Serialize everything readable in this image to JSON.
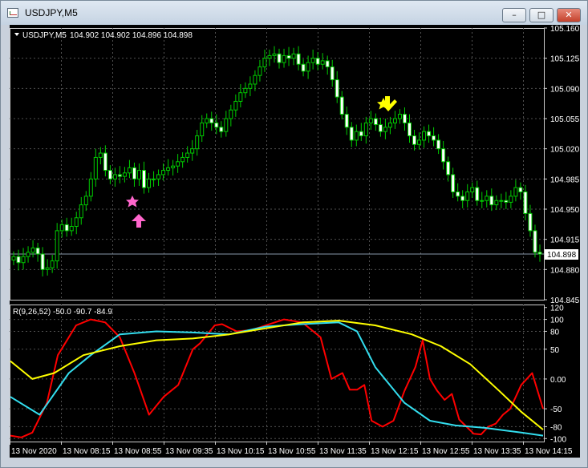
{
  "window": {
    "title": "USDJPY,M5",
    "minimize_label": "–",
    "maximize_label": "□",
    "close_label": "✕"
  },
  "colors": {
    "background": "#000000",
    "candle": "#00cc00",
    "grid": "#505050",
    "axis_text": "#ffffff",
    "sell_signal": "#ffff00",
    "buy_signal": "#ff66cc",
    "line_red": "#ff0000",
    "line_cyan": "#33ddee",
    "line_yellow": "#ffff00"
  },
  "main_chart": {
    "symbol_label": "USDJPY,M5",
    "ohlc_label": "104.902 104.902 104.896 104.898",
    "current_price_label": "104.898"
  },
  "indicator": {
    "label": "R(9,26,52) -50.0 -90.7 -84.9"
  },
  "chart_data": [
    {
      "type": "candlestick",
      "title": "USDJPY,M5",
      "ylim": [
        104.845,
        105.16
      ],
      "y_ticks": [
        "105.160",
        "105.125",
        "105.090",
        "105.055",
        "105.020",
        "104.985",
        "104.950",
        "104.915",
        "104.880",
        "104.845"
      ],
      "x_ticks": [
        "13 Nov 2020",
        "13 Nov 08:15",
        "13 Nov 08:55",
        "13 Nov 09:35",
        "13 Nov 10:15",
        "13 Nov 10:55",
        "13 Nov 11:35",
        "13 Nov 12:15",
        "13 Nov 12:55",
        "13 Nov 13:35",
        "13 Nov 14:15"
      ],
      "current_price": 104.898,
      "close": [
        104.895,
        104.888,
        104.895,
        104.9,
        104.905,
        104.898,
        104.88,
        104.882,
        104.89,
        104.925,
        104.932,
        104.925,
        104.93,
        104.94,
        104.955,
        104.965,
        104.985,
        105.01,
        105.015,
        104.995,
        104.985,
        104.99,
        104.988,
        104.992,
        104.998,
        104.985,
        104.995,
        104.975,
        104.985,
        104.985,
        104.99,
        104.995,
        104.998,
        105.0,
        105.005,
        105.01,
        105.015,
        105.02,
        105.035,
        105.05,
        105.055,
        105.05,
        105.045,
        105.04,
        105.055,
        105.065,
        105.075,
        105.085,
        105.09,
        105.095,
        105.105,
        105.115,
        105.125,
        105.128,
        105.13,
        105.12,
        105.128,
        105.125,
        105.13,
        105.118,
        105.11,
        105.12,
        105.125,
        105.118,
        105.122,
        105.115,
        105.1,
        105.08,
        105.06,
        105.045,
        105.03,
        105.04,
        105.035,
        105.05,
        105.055,
        105.048,
        105.04,
        105.045,
        105.05,
        105.055,
        105.06,
        105.05,
        105.035,
        105.025,
        105.03,
        105.04,
        105.035,
        105.03,
        105.02,
        105.005,
        104.99,
        104.97,
        104.965,
        104.96,
        104.97,
        104.975,
        104.96,
        104.96,
        104.965,
        104.955,
        104.96,
        104.96,
        104.958,
        104.965,
        104.975,
        104.97,
        104.945,
        104.925,
        104.9,
        104.898
      ]
    },
    {
      "type": "line",
      "title": "R(9,26,52)",
      "ylim": [
        -105,
        125
      ],
      "y_ticks": [
        120,
        100,
        80,
        50,
        0,
        -50,
        -80,
        -100
      ],
      "series": [
        {
          "name": "R9",
          "color": "#ff0000",
          "x": [
            0,
            3,
            6,
            10,
            13,
            18,
            22,
            26,
            30,
            34,
            38,
            42,
            46,
            50,
            52,
            56,
            58,
            62,
            66,
            70,
            75,
            80,
            85,
            88,
            91,
            93,
            95,
            97,
            99,
            102,
            105,
            108,
            111,
            113,
            115,
            117,
            119,
            121,
            123,
            125,
            127,
            129,
            131,
            133,
            135,
            137,
            140,
            143,
            146
          ],
          "values": [
            -95,
            -98,
            -90,
            -40,
            40,
            90,
            100,
            95,
            70,
            10,
            -60,
            -30,
            -10,
            50,
            60,
            90,
            92,
            80,
            82,
            90,
            100,
            95,
            70,
            0,
            10,
            -18,
            -18,
            -10,
            -70,
            -80,
            -70,
            -20,
            20,
            65,
            0,
            -20,
            -35,
            -25,
            -68,
            -80,
            -92,
            -93,
            -80,
            -75,
            -60,
            -50,
            -10,
            10,
            -50
          ]
        },
        {
          "name": "R26",
          "color": "#33ddee",
          "x": [
            0,
            8,
            16,
            22,
            30,
            40,
            50,
            60,
            70,
            80,
            90,
            95,
            100,
            108,
            115,
            122,
            130,
            140,
            146
          ],
          "values": [
            -30,
            -60,
            10,
            40,
            75,
            80,
            78,
            75,
            88,
            92,
            95,
            80,
            20,
            -40,
            -70,
            -78,
            -82,
            -90,
            -95
          ]
        },
        {
          "name": "R52",
          "color": "#ffff00",
          "x": [
            0,
            6,
            12,
            20,
            30,
            40,
            50,
            60,
            70,
            80,
            90,
            100,
            110,
            118,
            126,
            134,
            140,
            146
          ],
          "values": [
            30,
            0,
            10,
            40,
            55,
            65,
            68,
            75,
            85,
            95,
            98,
            90,
            75,
            55,
            25,
            -20,
            -55,
            -85
          ]
        }
      ]
    }
  ]
}
